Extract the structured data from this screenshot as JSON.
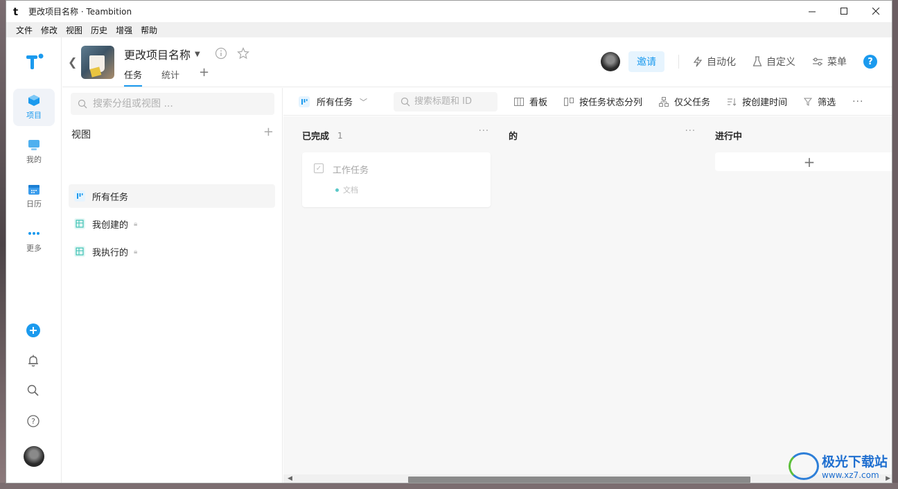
{
  "window": {
    "app_letter": "t",
    "title": "更改项目名称 · Teambition",
    "controls": [
      "minimize-icon",
      "maximize-icon",
      "close-icon"
    ]
  },
  "menubar": [
    "文件",
    "修改",
    "视图",
    "历史",
    "增强",
    "帮助"
  ],
  "rail": {
    "items": [
      {
        "label": "项目",
        "icon": "project-icon",
        "active": true
      },
      {
        "label": "我的",
        "icon": "mine-icon",
        "active": false
      },
      {
        "label": "日历",
        "icon": "calendar-icon",
        "active": false
      },
      {
        "label": "更多",
        "icon": "more-dots-icon",
        "active": false
      }
    ],
    "bottom": [
      "add-icon",
      "bell-icon",
      "search-icon",
      "help-circle-icon",
      "avatar"
    ]
  },
  "project": {
    "name": "更改项目名称",
    "tabs": [
      {
        "label": "任务",
        "active": true
      },
      {
        "label": "统计",
        "active": false
      }
    ],
    "invite_label": "邀请",
    "automation_label": "自动化",
    "customize_label": "自定义",
    "menu_label": "菜单",
    "help_label": "?"
  },
  "views": {
    "search_placeholder": "搜索分组或视图 ...",
    "title": "视图",
    "items": [
      {
        "label": "所有任务",
        "active": true,
        "locked": false
      },
      {
        "label": "我创建的",
        "active": false,
        "locked": true
      },
      {
        "label": "我执行的",
        "active": false,
        "locked": true
      }
    ]
  },
  "toolbar": {
    "current_view": "所有任务",
    "search_placeholder": "搜索标题和 ID",
    "board_label": "看板",
    "split_label": "按任务状态分列",
    "parent_only_label": "仅父任务",
    "sort_label": "按创建时间",
    "filter_label": "筛选"
  },
  "board": {
    "columns": [
      {
        "title": "已完成",
        "count": "1",
        "cards": [
          {
            "title": "工作任务",
            "tag": "文档"
          }
        ]
      },
      {
        "title": "的",
        "count": "",
        "cards": []
      },
      {
        "title": "进行中",
        "count": "",
        "cards": []
      }
    ]
  },
  "watermark": {
    "title": "极光下载站",
    "url": "www.xz7.com"
  },
  "colors": {
    "accent": "#1b9aee",
    "invite_bg": "#e6f4fe",
    "board_bg": "#f7f7f7",
    "tag_dot": "#5ac8c8"
  }
}
